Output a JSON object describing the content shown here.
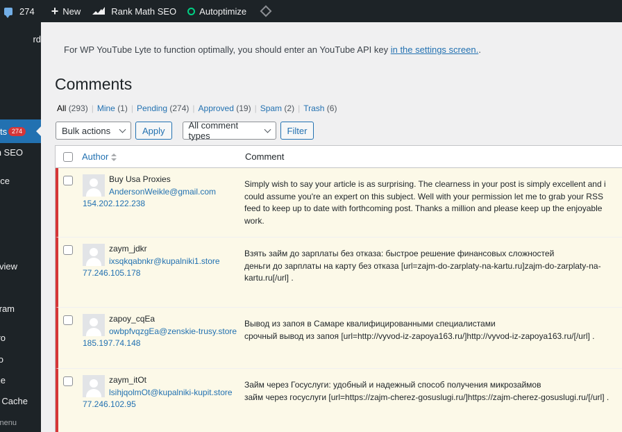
{
  "adminbar": {
    "comments_count": "274",
    "new_label": "New",
    "rankmath_label": "Rank Math SEO",
    "autoptimize_label": "Autoptimize"
  },
  "sidebar": {
    "items": [
      {
        "label": "rd"
      },
      {
        "label": "ts",
        "badge": "274"
      },
      {
        "label": "h SEO"
      },
      {
        "label": "nce"
      },
      {
        "label": "view"
      },
      {
        "label": "ram"
      },
      {
        "label": "ro"
      },
      {
        "label": "o"
      },
      {
        "label": "ze"
      },
      {
        "label": "l Cache"
      },
      {
        "label": "nenu"
      }
    ]
  },
  "notice": {
    "text": "For WP YouTube Lyte to function optimally, you should enter an YouTube API key ",
    "link": "in the settings screen.",
    "trail": "."
  },
  "page_title": "Comments",
  "filters": [
    {
      "label": "All",
      "count": "(293)",
      "current": true
    },
    {
      "label": "Mine",
      "count": "(1)"
    },
    {
      "label": "Pending",
      "count": "(274)"
    },
    {
      "label": "Approved",
      "count": "(19)"
    },
    {
      "label": "Spam",
      "count": "(2)"
    },
    {
      "label": "Trash",
      "count": "(6)"
    }
  ],
  "tablenav": {
    "bulk_actions": "Bulk actions",
    "apply": "Apply",
    "comment_types": "All comment types",
    "filter": "Filter"
  },
  "table": {
    "col_author": "Author",
    "col_comment": "Comment",
    "rows": [
      {
        "name": "Buy Usa Proxies",
        "email": "AndersonWeikle@gmail.com",
        "ip": "154.202.122.238",
        "comment": [
          "Simply wish to say your article is as surprising. The clearness in your post is simply excellent and i could assume you're an expert on this subject. Well with your permission let me to grab your RSS feed to keep up to date with forthcoming post. Thanks a million and please keep up the enjoyable work."
        ]
      },
      {
        "name": "zaym_jdkr",
        "email": "ixsqkqabnkr@kupalniki1.store",
        "ip": "77.246.105.178",
        "comment": [
          "Взять займ до зарплаты без отказа: быстрое решение финансовых сложностей",
          "деньги до зарплаты на карту без отказа [url=zajm-do-zarplaty-na-kartu.ru]zajm-do-zarplaty-na-kartu.ru[/url] ."
        ]
      },
      {
        "name": "zapoy_cqEa",
        "email": "owbpfvqzgEa@zenskie-trusy.store",
        "ip": "185.197.74.148",
        "comment": [
          "Вывод из запоя в Самаре квалифицированными специалистами",
          "срочный вывод из запоя [url=http://vyvod-iz-zapoya163.ru/]http://vyvod-iz-zapoya163.ru/[/url] ."
        ]
      },
      {
        "name": "zaym_itOt",
        "email": "lsihjqolmOt@kupalniki-kupit.store",
        "ip": "77.246.102.95",
        "comment": [
          "Займ через Госуслуги: удобный и надежный способ получения микрозаймов",
          "займ через госуслуги [url=https://zajm-cherez-gosuslugi.ru/]https://zajm-cherez-gosuslugi.ru/[/url] ."
        ]
      }
    ]
  }
}
